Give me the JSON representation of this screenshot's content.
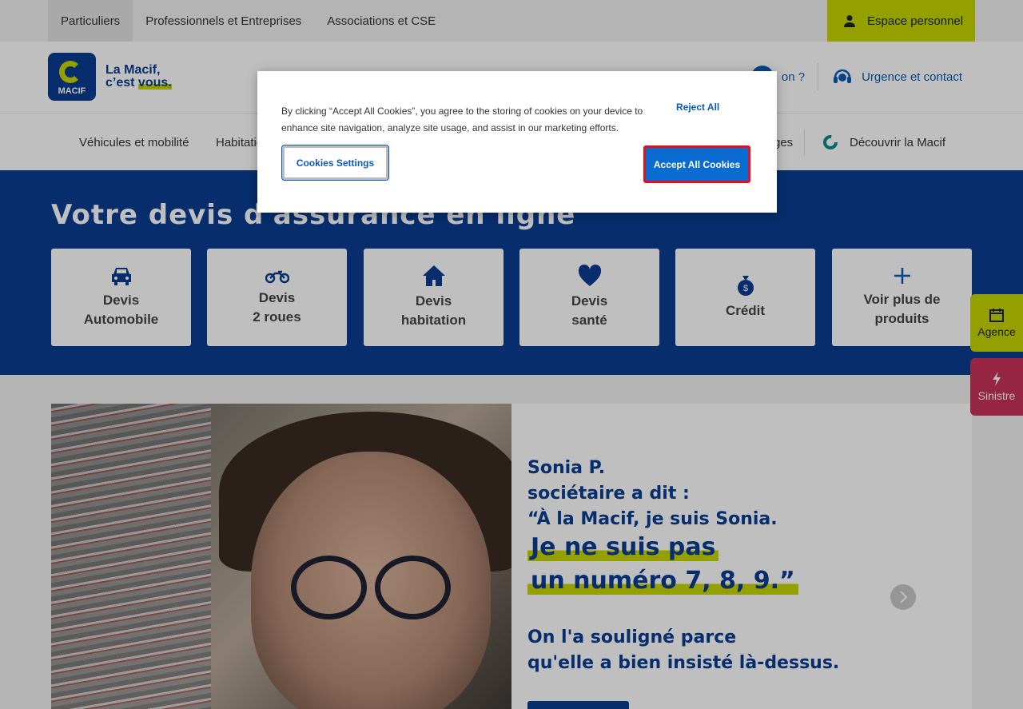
{
  "topbar": {
    "nav": [
      "Particuliers",
      "Professionnels et Entreprises",
      "Associations et CSE"
    ],
    "espace_label": "Espace personnel"
  },
  "header": {
    "logo_text": "MACIF",
    "slogan_line1": "La Macif,",
    "slogan_line2a": "c’est ",
    "slogan_line2b": "vous.",
    "question_label": "on ?",
    "urgence_label": "Urgence et contact"
  },
  "mainnav": {
    "vehicules": "Véhicules et mobilité",
    "habitation": "Habitatio",
    "ges": "ges",
    "decouvrir": "Découvrir la Macif"
  },
  "hero": {
    "title": "Votre devis d'assurance en ligne",
    "cards": [
      {
        "label": "Devis\nAutomobile",
        "icon": "car-icon"
      },
      {
        "label": "Devis\n2 roues",
        "icon": "motorbike-icon"
      },
      {
        "label": "Devis\nhabitation",
        "icon": "house-icon"
      },
      {
        "label": "Devis\nsanté",
        "icon": "heart-icon"
      },
      {
        "label": "Crédit",
        "icon": "money-bag-icon"
      },
      {
        "label": "Voir plus de\nproduits",
        "icon": "plus-icon"
      }
    ]
  },
  "testimonial": {
    "line1": "Sonia P.",
    "line2": "sociétaire a dit :",
    "line3": "“À la Macif, je suis Sonia.",
    "big1": "Je ne suis pas",
    "big2": "un numéro 7, 8, 9.”",
    "line4": "On l'a souligné parce",
    "line5": "qu'elle a bien insisté là-dessus."
  },
  "side": {
    "agence": "Agence",
    "sinistre": "Sinistre"
  },
  "cookie": {
    "message": "By clicking “Accept All Cookies”, you agree to the storing of cookies on your device to enhance site navigation, analyze site usage, and assist in our marketing efforts.",
    "reject": "Reject All",
    "settings": "Cookies Settings",
    "accept": "Accept All Cookies"
  },
  "colors": {
    "brand_blue": "#0a3d91",
    "accent_green": "#c4d600",
    "sinistre_red": "#c8325a",
    "accept_blue": "#0a6cd1",
    "focus_red": "#e3101b"
  }
}
